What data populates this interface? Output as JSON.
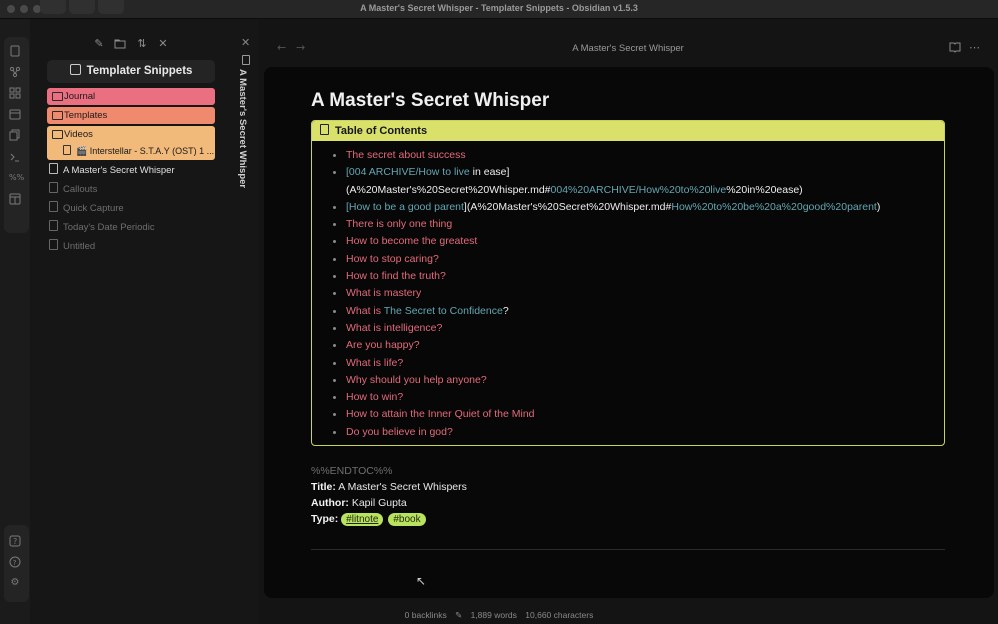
{
  "window": {
    "title": "A Master's Secret Whisper - Templater Snippets - Obsidian v1.5.3"
  },
  "sidebar": {
    "vault_name": "Templater Snippets",
    "folders": [
      {
        "label": "Journal",
        "color": "#ea6f80"
      },
      {
        "label": "Templates",
        "color": "#ef8a6e"
      },
      {
        "label": "Videos",
        "color": "#f1b97a"
      }
    ],
    "video_file": "🎬 Interstellar - S.T.A.Y (OST) 1 ...",
    "files": [
      {
        "label": "A Master's Secret Whisper",
        "active": true
      },
      {
        "label": "Callouts"
      },
      {
        "label": "Quick Capture"
      },
      {
        "label": "Today's Date Periodic"
      },
      {
        "label": "Untitled"
      }
    ]
  },
  "tab": {
    "vertical_title": "A Master's Secret Whisper"
  },
  "header": {
    "title": "A Master's Secret Whisper"
  },
  "note": {
    "title": "A Master's Secret Whisper",
    "toc_title": "Table of Contents",
    "toc": {
      "i1": "The secret about success",
      "i2a": "[004 ARCHIVE/How to live",
      "i2b": " in ease]",
      "i2c": "(A%20Master's%20Secret%20Whisper.md#",
      "i2d": "004%20ARCHIVE/How%20to%20live",
      "i2e": "%20in%20ease)",
      "i3a": "[How to be a good parent",
      "i3b": "](A%20Master's%20Secret%20Whisper.md#",
      "i3c": "How%20to%20be%20a%20good%20parent",
      "i3d": ")",
      "i4": "There is only one thing",
      "i5": "How to become the greatest",
      "i6": "How to stop caring?",
      "i7": "How to find the truth?",
      "i8": "What is mastery",
      "i9a": "What is ",
      "i9b": "The Secret to Confidence",
      "i9c": "?",
      "i10": "What is intelligence?",
      "i11": "Are you happy?",
      "i12": "What is life?",
      "i13": "Why should you help anyone?",
      "i14": "How to win?",
      "i15": "How to attain the Inner Quiet of the Mind",
      "i16": "Do you believe in god?"
    },
    "endtoc": "%%ENDTOC%%",
    "title_label": "Title:",
    "title_value": " A Master's Secret Whispers",
    "author_label": "Author:",
    "author_value": " Kapil Gupta",
    "type_label": "Type:",
    "tags": [
      "#litnote",
      "#book"
    ]
  },
  "status": {
    "backlinks": "0 backlinks",
    "words": "1,889 words",
    "characters": "10,660 characters"
  }
}
